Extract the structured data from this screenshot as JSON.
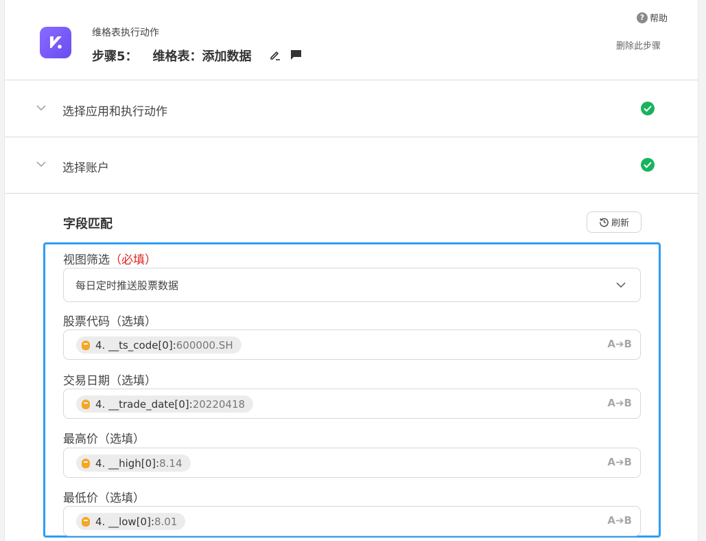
{
  "header": {
    "subtitle": "维格表执行动作",
    "step_label": "步骤5：",
    "step_name": "维格表：添加数据",
    "help_icon_glyph": "?",
    "help_label": "帮助",
    "delete_label": "删除此步骤",
    "logo_color": "#7b5cf7"
  },
  "sections": [
    {
      "label": "选择应用和执行动作",
      "status": "complete"
    },
    {
      "label": "选择账户",
      "status": "complete"
    }
  ],
  "mapping": {
    "title": "字段匹配",
    "refresh_label": "刷新",
    "view_filter": {
      "label": "视图筛选",
      "required_tag": "（必填）",
      "value": "每日定时推送股票数据"
    },
    "fields": [
      {
        "label": "股票代码（选填）",
        "chip_key": "4. __ts_code[0]:",
        "chip_value": " 600000.SH",
        "mode_icon": "A➔B"
      },
      {
        "label": "交易日期（选填）",
        "chip_key": "4. __trade_date[0]:",
        "chip_value": " 20220418",
        "mode_icon": "A➔B"
      },
      {
        "label": "最高价（选填）",
        "chip_key": "4. __high[0]:",
        "chip_value": " 8.14",
        "mode_icon": "A➔B"
      },
      {
        "label": "最低价（选填）",
        "chip_key": "4. __low[0]:",
        "chip_value": " 8.01",
        "mode_icon": "A➔B"
      }
    ]
  },
  "colors": {
    "accent_border": "#2d9cf5",
    "success": "#19b35e",
    "required": "#e02020"
  }
}
